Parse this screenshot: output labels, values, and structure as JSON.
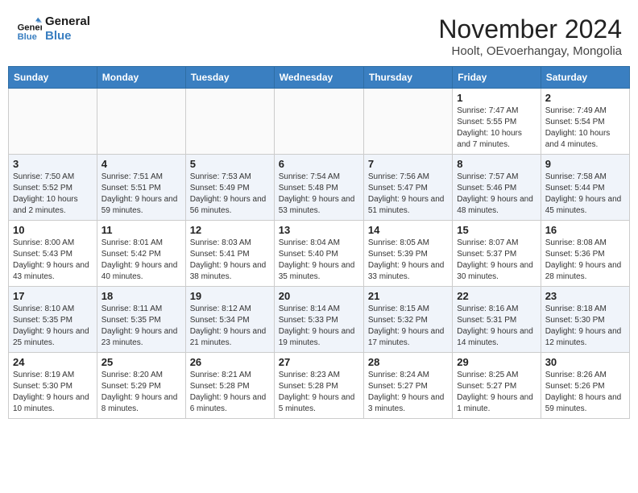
{
  "header": {
    "logo_line1": "General",
    "logo_line2": "Blue",
    "month_title": "November 2024",
    "location": "Hoolt, OEvoerhangay, Mongolia"
  },
  "weekdays": [
    "Sunday",
    "Monday",
    "Tuesday",
    "Wednesday",
    "Thursday",
    "Friday",
    "Saturday"
  ],
  "weeks": [
    [
      {
        "day": "",
        "info": ""
      },
      {
        "day": "",
        "info": ""
      },
      {
        "day": "",
        "info": ""
      },
      {
        "day": "",
        "info": ""
      },
      {
        "day": "",
        "info": ""
      },
      {
        "day": "1",
        "info": "Sunrise: 7:47 AM\nSunset: 5:55 PM\nDaylight: 10 hours and 7 minutes."
      },
      {
        "day": "2",
        "info": "Sunrise: 7:49 AM\nSunset: 5:54 PM\nDaylight: 10 hours and 4 minutes."
      }
    ],
    [
      {
        "day": "3",
        "info": "Sunrise: 7:50 AM\nSunset: 5:52 PM\nDaylight: 10 hours and 2 minutes."
      },
      {
        "day": "4",
        "info": "Sunrise: 7:51 AM\nSunset: 5:51 PM\nDaylight: 9 hours and 59 minutes."
      },
      {
        "day": "5",
        "info": "Sunrise: 7:53 AM\nSunset: 5:49 PM\nDaylight: 9 hours and 56 minutes."
      },
      {
        "day": "6",
        "info": "Sunrise: 7:54 AM\nSunset: 5:48 PM\nDaylight: 9 hours and 53 minutes."
      },
      {
        "day": "7",
        "info": "Sunrise: 7:56 AM\nSunset: 5:47 PM\nDaylight: 9 hours and 51 minutes."
      },
      {
        "day": "8",
        "info": "Sunrise: 7:57 AM\nSunset: 5:46 PM\nDaylight: 9 hours and 48 minutes."
      },
      {
        "day": "9",
        "info": "Sunrise: 7:58 AM\nSunset: 5:44 PM\nDaylight: 9 hours and 45 minutes."
      }
    ],
    [
      {
        "day": "10",
        "info": "Sunrise: 8:00 AM\nSunset: 5:43 PM\nDaylight: 9 hours and 43 minutes."
      },
      {
        "day": "11",
        "info": "Sunrise: 8:01 AM\nSunset: 5:42 PM\nDaylight: 9 hours and 40 minutes."
      },
      {
        "day": "12",
        "info": "Sunrise: 8:03 AM\nSunset: 5:41 PM\nDaylight: 9 hours and 38 minutes."
      },
      {
        "day": "13",
        "info": "Sunrise: 8:04 AM\nSunset: 5:40 PM\nDaylight: 9 hours and 35 minutes."
      },
      {
        "day": "14",
        "info": "Sunrise: 8:05 AM\nSunset: 5:39 PM\nDaylight: 9 hours and 33 minutes."
      },
      {
        "day": "15",
        "info": "Sunrise: 8:07 AM\nSunset: 5:37 PM\nDaylight: 9 hours and 30 minutes."
      },
      {
        "day": "16",
        "info": "Sunrise: 8:08 AM\nSunset: 5:36 PM\nDaylight: 9 hours and 28 minutes."
      }
    ],
    [
      {
        "day": "17",
        "info": "Sunrise: 8:10 AM\nSunset: 5:35 PM\nDaylight: 9 hours and 25 minutes."
      },
      {
        "day": "18",
        "info": "Sunrise: 8:11 AM\nSunset: 5:35 PM\nDaylight: 9 hours and 23 minutes."
      },
      {
        "day": "19",
        "info": "Sunrise: 8:12 AM\nSunset: 5:34 PM\nDaylight: 9 hours and 21 minutes."
      },
      {
        "day": "20",
        "info": "Sunrise: 8:14 AM\nSunset: 5:33 PM\nDaylight: 9 hours and 19 minutes."
      },
      {
        "day": "21",
        "info": "Sunrise: 8:15 AM\nSunset: 5:32 PM\nDaylight: 9 hours and 17 minutes."
      },
      {
        "day": "22",
        "info": "Sunrise: 8:16 AM\nSunset: 5:31 PM\nDaylight: 9 hours and 14 minutes."
      },
      {
        "day": "23",
        "info": "Sunrise: 8:18 AM\nSunset: 5:30 PM\nDaylight: 9 hours and 12 minutes."
      }
    ],
    [
      {
        "day": "24",
        "info": "Sunrise: 8:19 AM\nSunset: 5:30 PM\nDaylight: 9 hours and 10 minutes."
      },
      {
        "day": "25",
        "info": "Sunrise: 8:20 AM\nSunset: 5:29 PM\nDaylight: 9 hours and 8 minutes."
      },
      {
        "day": "26",
        "info": "Sunrise: 8:21 AM\nSunset: 5:28 PM\nDaylight: 9 hours and 6 minutes."
      },
      {
        "day": "27",
        "info": "Sunrise: 8:23 AM\nSunset: 5:28 PM\nDaylight: 9 hours and 5 minutes."
      },
      {
        "day": "28",
        "info": "Sunrise: 8:24 AM\nSunset: 5:27 PM\nDaylight: 9 hours and 3 minutes."
      },
      {
        "day": "29",
        "info": "Sunrise: 8:25 AM\nSunset: 5:27 PM\nDaylight: 9 hours and 1 minute."
      },
      {
        "day": "30",
        "info": "Sunrise: 8:26 AM\nSunset: 5:26 PM\nDaylight: 8 hours and 59 minutes."
      }
    ]
  ]
}
